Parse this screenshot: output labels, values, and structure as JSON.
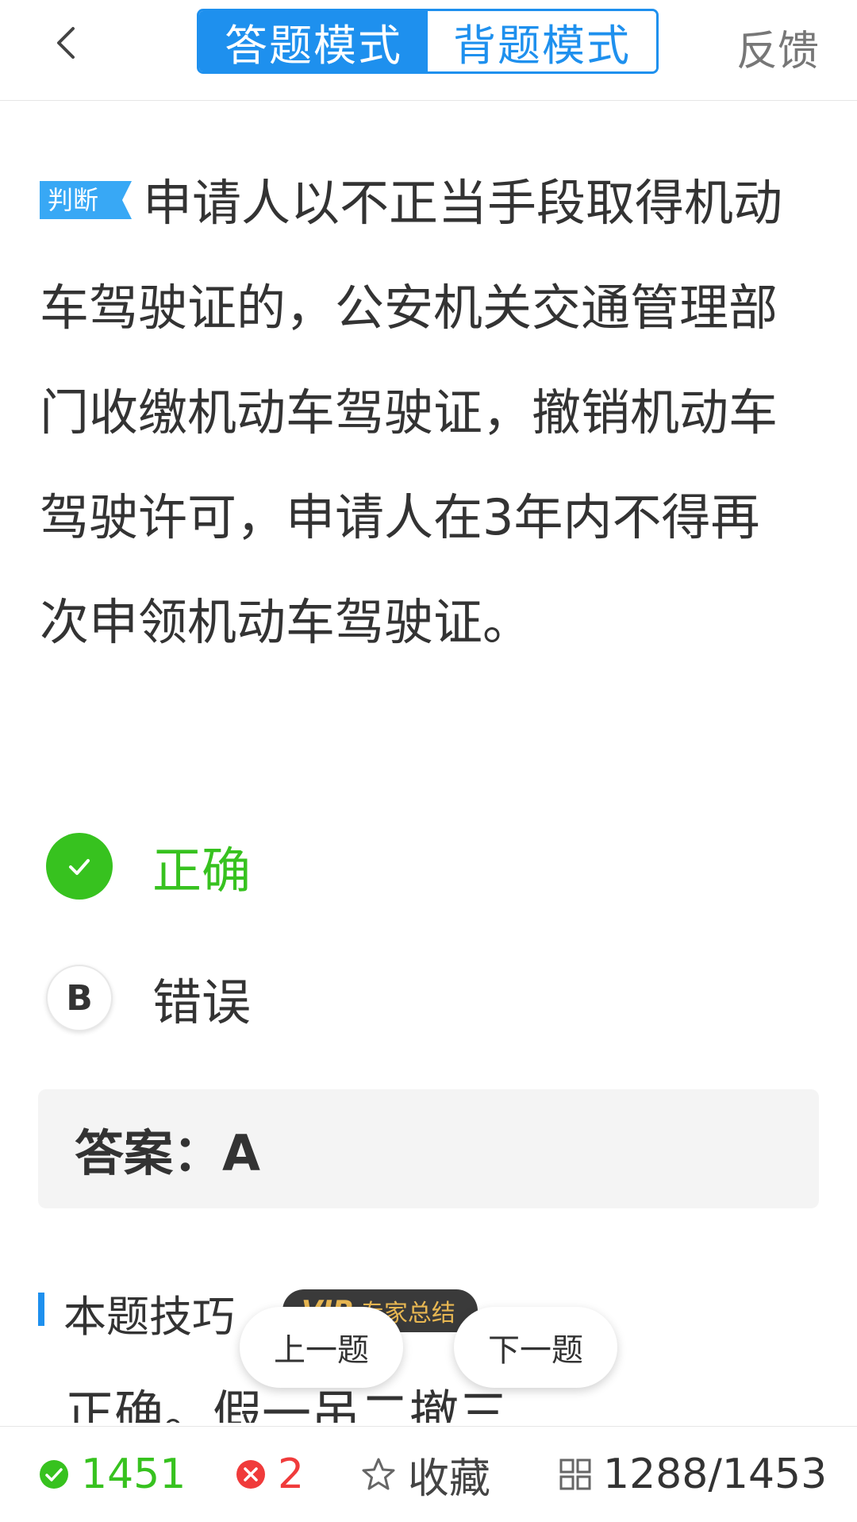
{
  "header": {
    "tabs": [
      {
        "label": "答题模式",
        "active": true
      },
      {
        "label": "背题模式",
        "active": false
      }
    ],
    "feedback": "反馈"
  },
  "question": {
    "type_tag": "判断",
    "text": "申请人以不正当手段取得机动车驾驶证的，公安机关交通管理部门收缴机动车驾驶证，撤销机动车驾驶许可，申请人在3年内不得再次申领机动车驾驶证。"
  },
  "options": [
    {
      "letter": "A",
      "label": "正确",
      "state": "correct"
    },
    {
      "letter": "B",
      "label": "错误",
      "state": "normal"
    }
  ],
  "answer": "答案：A",
  "tips": {
    "title": "本题技巧",
    "badge_vip": "VIP",
    "badge_text": "专家总结",
    "text": "正确。假一吊二撤三"
  },
  "nav": {
    "prev": "上一题",
    "next": "下一题"
  },
  "bottom": {
    "correct_count": "1451",
    "wrong_count": "2",
    "favorite": "收藏",
    "progress": "1288/1453"
  },
  "colors": {
    "accent": "#1e90ee",
    "correct": "#37c21f",
    "wrong": "#f03b3b"
  }
}
